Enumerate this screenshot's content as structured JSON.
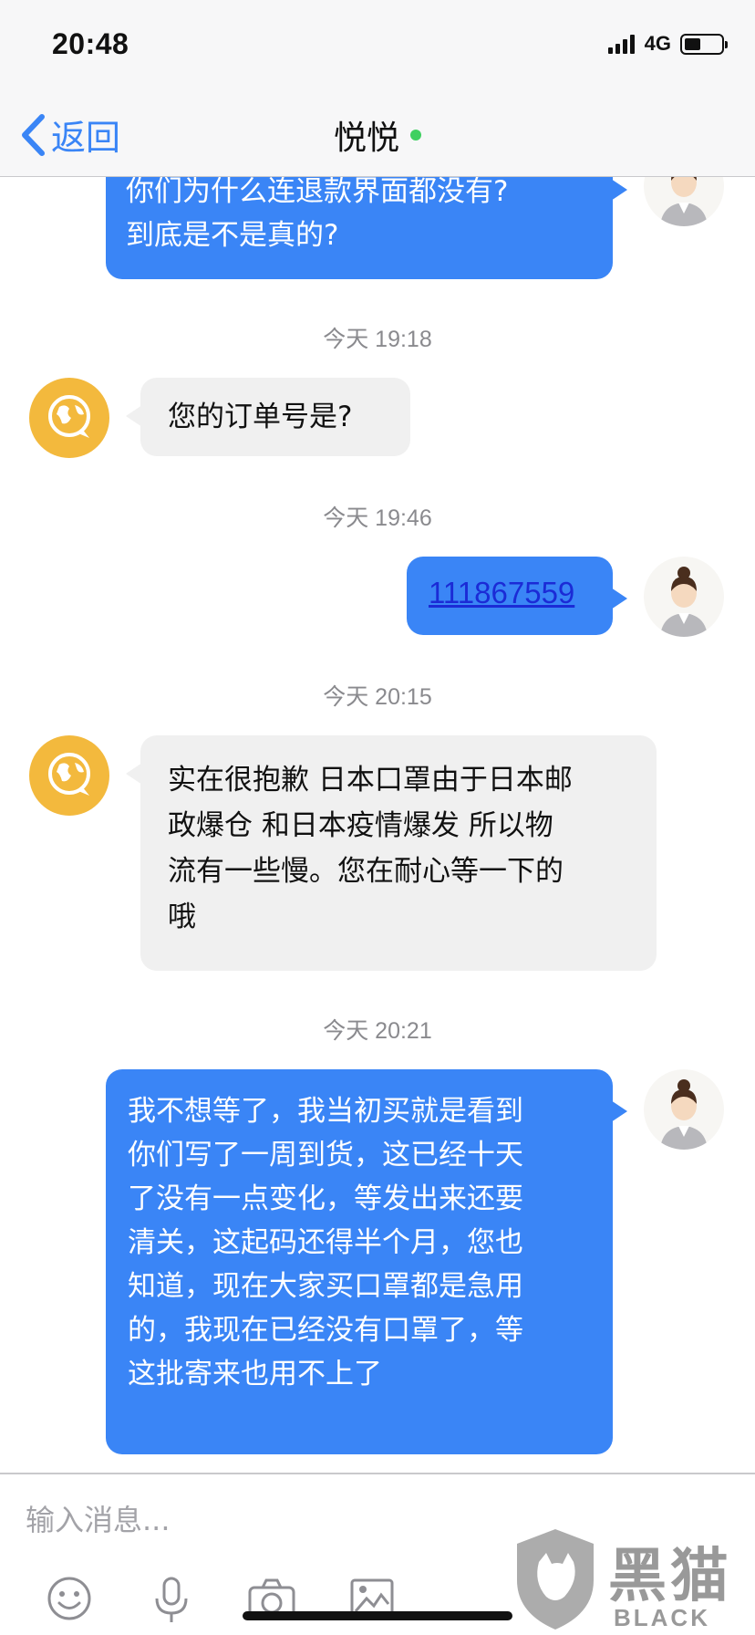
{
  "status_bar": {
    "time": "20:48",
    "network": "4G",
    "battery_level": 0.4
  },
  "nav": {
    "back_label": "返回",
    "title": "悦悦",
    "online_color": "#3fd060"
  },
  "messages": [
    {
      "type": "outgoing",
      "lines": [
        "你们为什么连退款界面都没有?",
        "到底是不是真的?"
      ]
    },
    {
      "type": "time",
      "text": "今天 19:18"
    },
    {
      "type": "incoming",
      "lines": [
        "您的订单号是?"
      ]
    },
    {
      "type": "time",
      "text": "今天 19:46"
    },
    {
      "type": "outgoing",
      "link": "111867559"
    },
    {
      "type": "time",
      "text": "今天 20:15"
    },
    {
      "type": "incoming",
      "lines": [
        "实在很抱歉 日本口罩由于日本邮",
        "政爆仓 和日本疫情爆发 所以物",
        "流有一些慢。您在耐心等一下的",
        "哦"
      ]
    },
    {
      "type": "time",
      "text": "今天 20:21"
    },
    {
      "type": "outgoing",
      "lines": [
        "我不想等了，我当初买就是看到",
        "你们写了一周到货，这已经十天",
        "了没有一点变化，等发出来还要",
        "清关，这起码还得半个月，您也",
        "知道，现在大家买口罩都是急用",
        "的，我现在已经没有口罩了，等",
        "这批寄来也用不上了"
      ]
    }
  ],
  "input": {
    "placeholder": "输入消息..."
  },
  "toolbar": {
    "icons": [
      "emoji-icon",
      "microphone-icon",
      "camera-icon",
      "image-icon"
    ]
  },
  "colors": {
    "outgoing_bubble": "#3a85f6",
    "incoming_bubble": "#f0f0f0",
    "agent_avatar": "#f3b93d",
    "link": "#1b2bd6"
  },
  "watermark": {
    "title": "黑猫",
    "subtitle": "BLACK CAT"
  }
}
